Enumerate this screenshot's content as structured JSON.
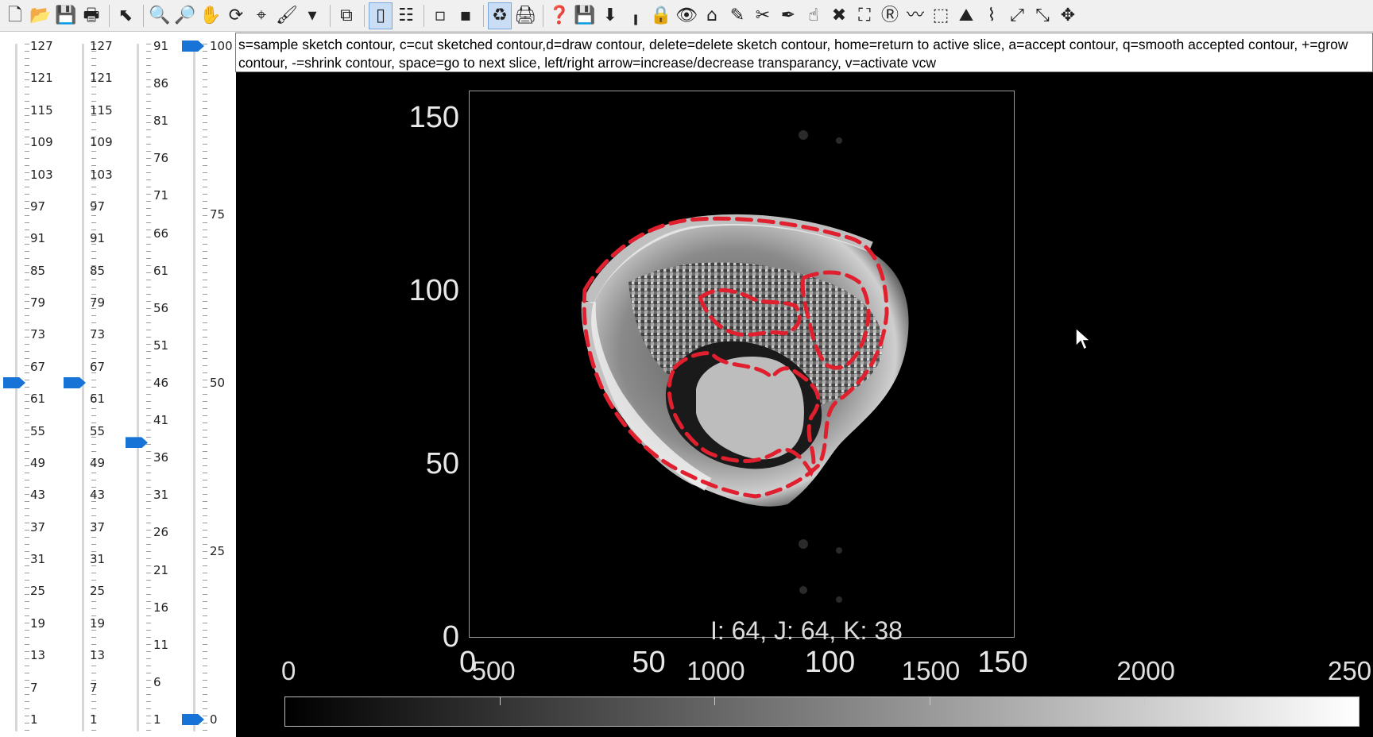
{
  "toolbar": {
    "buttons": [
      {
        "name": "new-file-icon",
        "glyph": "🗋"
      },
      {
        "name": "open-folder-icon",
        "glyph": "📂"
      },
      {
        "name": "save-icon",
        "glyph": "💾"
      },
      {
        "name": "print-icon",
        "glyph": "🖶"
      },
      {
        "name": "sep"
      },
      {
        "name": "pointer-icon",
        "glyph": "⬉"
      },
      {
        "name": "sep"
      },
      {
        "name": "zoom-in-icon",
        "glyph": "🔍"
      },
      {
        "name": "zoom-out-icon",
        "glyph": "🔎"
      },
      {
        "name": "pan-hand-icon",
        "glyph": "✋"
      },
      {
        "name": "rotate-3d-icon",
        "glyph": "⟳"
      },
      {
        "name": "data-cursor-icon",
        "glyph": "⌖"
      },
      {
        "name": "brush-icon",
        "glyph": "🖌"
      },
      {
        "name": "dropdown-arrow-icon",
        "glyph": "▾"
      },
      {
        "name": "sep"
      },
      {
        "name": "link-plot-icon",
        "glyph": "⧉"
      },
      {
        "name": "sep"
      },
      {
        "name": "colorbar-icon",
        "glyph": "▯",
        "active": true
      },
      {
        "name": "legend-icon",
        "glyph": "☷"
      },
      {
        "name": "sep"
      },
      {
        "name": "hide-plot-tools-icon",
        "glyph": "▫"
      },
      {
        "name": "show-plot-tools-icon",
        "glyph": "▪"
      },
      {
        "name": "sep"
      },
      {
        "name": "refresh-icon",
        "glyph": "♻",
        "active": true
      },
      {
        "name": "print-preview-icon",
        "glyph": "🖨"
      },
      {
        "name": "sep"
      },
      {
        "name": "help-icon",
        "glyph": "❓"
      },
      {
        "name": "save-disk-icon",
        "glyph": "💾"
      },
      {
        "name": "download-icon",
        "glyph": "⬇"
      },
      {
        "name": "brightness-icon",
        "glyph": "╻"
      },
      {
        "name": "lock-icon",
        "glyph": "🔒"
      },
      {
        "name": "eye-icon",
        "glyph": "👁"
      },
      {
        "name": "home-icon",
        "glyph": "⌂"
      },
      {
        "name": "eyedropper-icon",
        "glyph": "✎"
      },
      {
        "name": "scissors-icon",
        "glyph": "✂"
      },
      {
        "name": "pen-icon",
        "glyph": "✒"
      },
      {
        "name": "hand-icon",
        "glyph": "☝"
      },
      {
        "name": "close-x-icon",
        "glyph": "✖"
      },
      {
        "name": "crop-icon",
        "glyph": "⛶"
      },
      {
        "name": "roi-r-icon",
        "glyph": "Ⓡ"
      },
      {
        "name": "contour-tool-icon",
        "glyph": "〰"
      },
      {
        "name": "dashed-box-icon",
        "glyph": "⬚"
      },
      {
        "name": "ruler-icon",
        "glyph": "⛰"
      },
      {
        "name": "lasso-icon",
        "glyph": "⌇"
      },
      {
        "name": "expand-icon",
        "glyph": "⤢"
      },
      {
        "name": "collapse-icon",
        "glyph": "⤡"
      },
      {
        "name": "move-icon",
        "glyph": "✥"
      }
    ]
  },
  "sliders": [
    {
      "name": "slider-1",
      "labels": [
        "127",
        "121",
        "115",
        "109",
        "103",
        "97",
        "91",
        "85",
        "79",
        "73",
        "67",
        "61",
        "55",
        "49",
        "43",
        "37",
        "31",
        "25",
        "19",
        "13",
        "7",
        "1"
      ],
      "value": 64
    },
    {
      "name": "slider-2",
      "labels": [
        "127",
        "121",
        "115",
        "109",
        "103",
        "97",
        "91",
        "85",
        "79",
        "73",
        "67",
        "61",
        "55",
        "49",
        "43",
        "37",
        "31",
        "25",
        "19",
        "13",
        "7",
        "1"
      ],
      "value": 64
    },
    {
      "name": "slider-3",
      "labels": [
        "91",
        "86",
        "81",
        "76",
        "71",
        "66",
        "61",
        "56",
        "51",
        "46",
        "41",
        "36",
        "31",
        "26",
        "21",
        "16",
        "11",
        "6",
        "1"
      ],
      "value": 38
    },
    {
      "name": "slider-4",
      "labels": [
        "100",
        "75",
        "50",
        "25",
        "0"
      ],
      "thumbs": [
        100,
        0
      ]
    }
  ],
  "instructions": "s=sample sketch contour, c=cut sketched contour,d=draw contour, delete=delete sketch contour, home=return to active slice, a=accept contour, q=smooth accepted contour, +=grow contour, -=shrink contour, space=go to next slice, left/right arrow=increase/decrease transparancy, v=activate vcw",
  "plot": {
    "y_ticks": [
      "150",
      "100",
      "50",
      "0"
    ],
    "x_ticks": [
      "0",
      "50",
      "100",
      "150"
    ],
    "status": "I: 64, J:  64, K: 38"
  },
  "colorbar": {
    "ticks": [
      "0",
      "500",
      "1000",
      "1500",
      "2000",
      "250"
    ]
  },
  "colors": {
    "contour": "#e0202f",
    "background": "#000000"
  }
}
